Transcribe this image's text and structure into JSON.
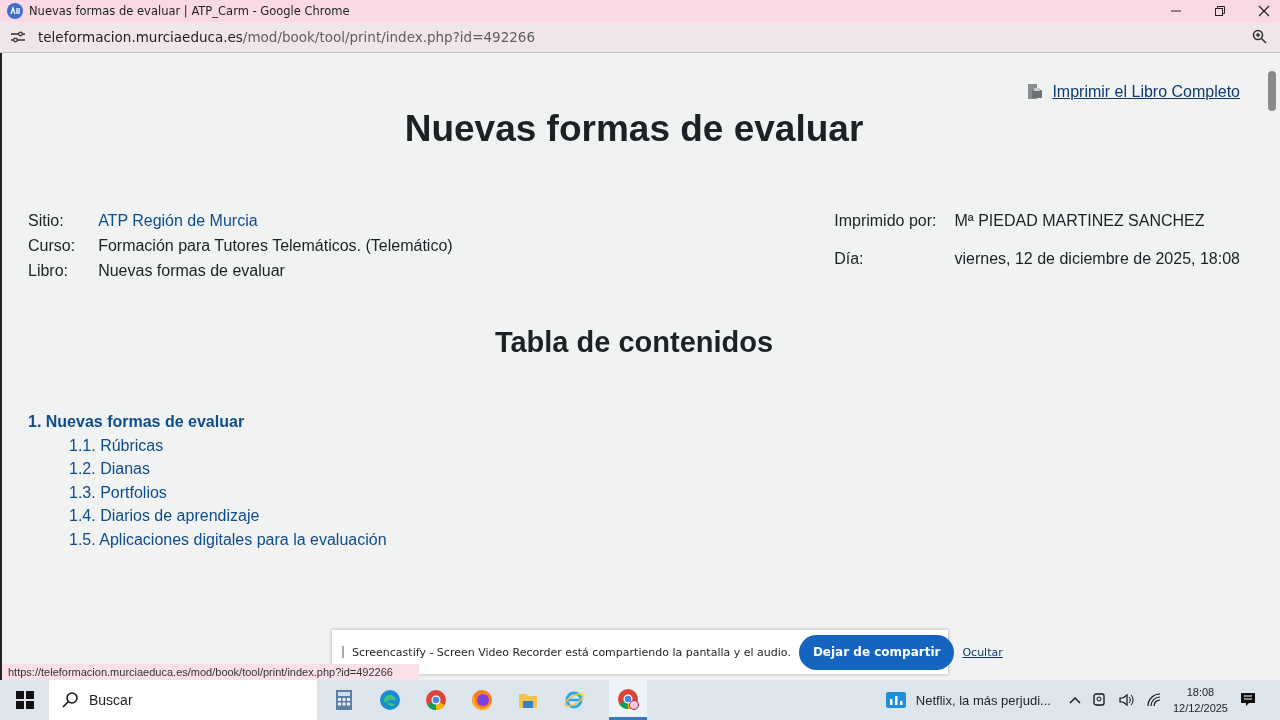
{
  "window": {
    "title": "Nuevas formas de evaluar | ATP_Carm - Google Chrome"
  },
  "address_bar": {
    "host": "teleformacion.murciaeduca.es",
    "path": "/mod/book/tool/print/index.php?id=492266"
  },
  "page": {
    "print_link": "Imprimir el Libro Completo",
    "title": "Nuevas formas de evaluar",
    "info_left": [
      {
        "label": "Sitio:",
        "value": "ATP Región de Murcia",
        "kind": "link"
      },
      {
        "label": "Curso:",
        "value": "Formación para Tutores Telemáticos. (Telemático)",
        "kind": "text"
      },
      {
        "label": "Libro:",
        "value": "Nuevas formas de evaluar",
        "kind": "text"
      }
    ],
    "info_right": [
      {
        "label": "Imprimido por:",
        "value": "Mª PIEDAD MARTINEZ SANCHEZ"
      },
      {
        "label": "Día:",
        "value": "viernes, 12 de diciembre de 2025, 18:08"
      }
    ],
    "toc_title": "Tabla de contenidos",
    "toc": [
      {
        "label": "1. Nuevas formas de evaluar",
        "children": [
          {
            "label": "1.1. Rúbricas"
          },
          {
            "label": "1.2. Dianas"
          },
          {
            "label": "1.3. Portfolios"
          },
          {
            "label": "1.4. Diarios de aprendizaje"
          },
          {
            "label": "1.5. Aplicaciones digitales para la evaluación"
          }
        ]
      }
    ]
  },
  "sharing_bar": {
    "message": "Screencastify - Screen Video Recorder está compartiendo la pantalla y el audio.",
    "stop_button": "Dejar de compartir",
    "hide_link": "Ocultar"
  },
  "status_url": "https://teleformacion.murciaeduca.es/mod/book/tool/print/index.php?id=492266",
  "taskbar": {
    "search_placeholder": "Buscar",
    "news": "Netflix, la más perjudi...",
    "time": "18:08",
    "date": "12/12/2025"
  }
}
